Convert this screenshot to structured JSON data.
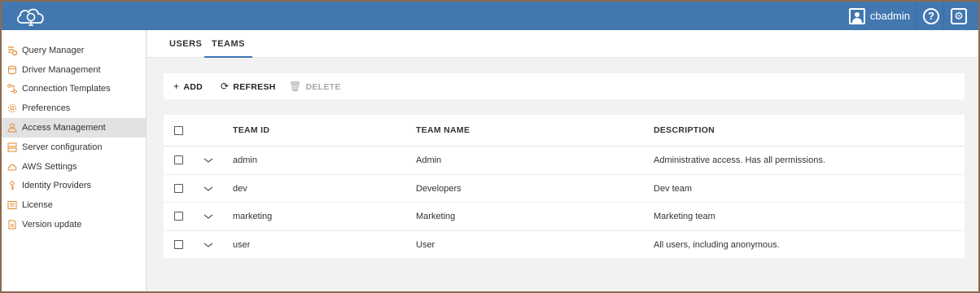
{
  "topbar": {
    "user_name": "cbadmin",
    "help_label": "?",
    "settings_glyph": "⚙",
    "bg_color": "#4277b0"
  },
  "sidebar": {
    "items": [
      {
        "label": "Query Manager",
        "icon": "query-manager-icon"
      },
      {
        "label": "Driver Management",
        "icon": "database-icon"
      },
      {
        "label": "Connection Templates",
        "icon": "connection-icon"
      },
      {
        "label": "Preferences",
        "icon": "gear-icon"
      },
      {
        "label": "Access Management",
        "icon": "user-icon",
        "active": true
      },
      {
        "label": "Server configuration",
        "icon": "server-icon"
      },
      {
        "label": "AWS Settings",
        "icon": "cloud-icon"
      },
      {
        "label": "Identity Providers",
        "icon": "key-icon"
      },
      {
        "label": "License",
        "icon": "license-icon"
      },
      {
        "label": "Version update",
        "icon": "document-icon"
      }
    ],
    "icon_color": "#e08a2a"
  },
  "tabs": [
    {
      "label": "USERS",
      "active": false
    },
    {
      "label": "TEAMS",
      "active": true
    }
  ],
  "toolbar": {
    "add_label": "ADD",
    "refresh_label": "REFRESH",
    "delete_label": "DELETE"
  },
  "table": {
    "columns": [
      "TEAM ID",
      "TEAM NAME",
      "DESCRIPTION"
    ],
    "rows": [
      {
        "team_id": "admin",
        "team_name": "Admin",
        "description": "Administrative access. Has all permissions."
      },
      {
        "team_id": "dev",
        "team_name": "Developers",
        "description": "Dev team"
      },
      {
        "team_id": "marketing",
        "team_name": "Marketing",
        "description": "Marketing team"
      },
      {
        "team_id": "user",
        "team_name": "User",
        "description": "All users, including anonymous."
      }
    ]
  }
}
